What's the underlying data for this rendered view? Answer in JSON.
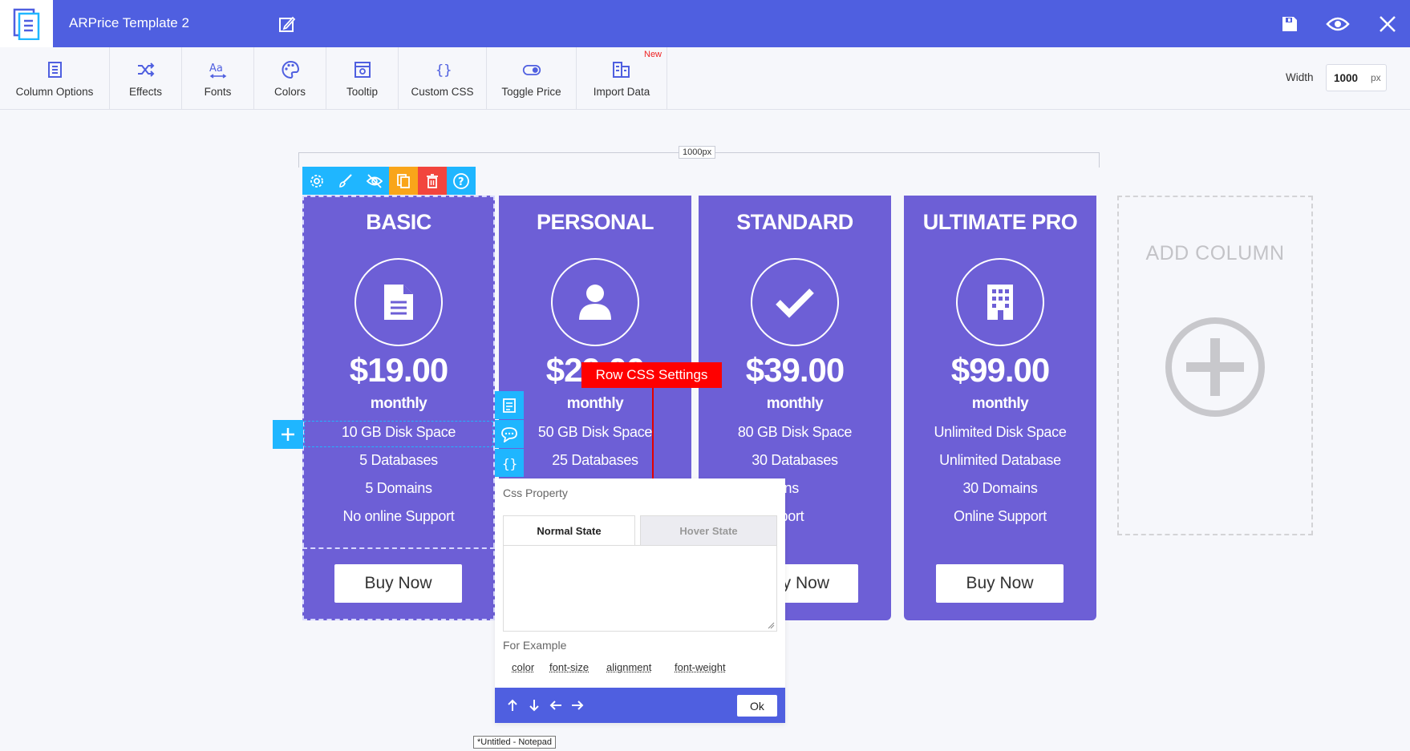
{
  "app": {
    "title": "ARPrice Template 2"
  },
  "toolbar": {
    "items": [
      {
        "label": "Column Options",
        "icon": "column-options-icon"
      },
      {
        "label": "Effects",
        "icon": "shuffle-icon"
      },
      {
        "label": "Fonts",
        "icon": "fonts-icon"
      },
      {
        "label": "Colors",
        "icon": "palette-icon"
      },
      {
        "label": "Tooltip",
        "icon": "tooltip-icon"
      },
      {
        "label": "Custom CSS",
        "icon": "braces-icon"
      },
      {
        "label": "Toggle Price",
        "icon": "toggle-icon"
      },
      {
        "label": "Import Data",
        "icon": "import-icon"
      }
    ],
    "new_badge": "New",
    "width_label": "Width",
    "width_value": "1000",
    "width_unit": "px"
  },
  "ruler_label": "1000px",
  "columns": [
    {
      "title": "BASIC",
      "icon": "document-icon",
      "price": "$19.00",
      "period": "monthly",
      "rows": [
        "10 GB Disk Space",
        "5 Databases",
        "5 Domains",
        "No online Support"
      ],
      "button": "Buy Now"
    },
    {
      "title": "PERSONAL",
      "icon": "user-icon",
      "price": "$29.00",
      "period": "monthly",
      "rows": [
        "50 GB Disk Space",
        "25 Databases",
        "",
        ""
      ],
      "button": ""
    },
    {
      "title": "STANDARD",
      "icon": "checkmark-icon",
      "price": "$39.00",
      "period": "monthly",
      "rows": [
        "80 GB Disk Space",
        "30 Databases",
        "Domains",
        "e Support"
      ],
      "button": "y Now"
    },
    {
      "title": "ULTIMATE PRO",
      "icon": "building-icon",
      "price": "$99.00",
      "period": "monthly",
      "rows": [
        "Unlimited Disk Space",
        "Unlimited Database",
        "30 Domains",
        "Online Support"
      ],
      "button": "Buy Now"
    }
  ],
  "add_column": {
    "label": "ADD COLUMN"
  },
  "tooltip": {
    "text": "Row CSS Settings"
  },
  "css_panel": {
    "title": "Css Property",
    "tabs": [
      "Normal State",
      "Hover State"
    ],
    "example_label": "For Example",
    "examples": [
      "color",
      "font-size",
      "alignment",
      "font-weight"
    ],
    "ok_label": "Ok"
  },
  "taskbar_tooltip": "*Untitled - Notepad",
  "colors": {
    "topbar": "#4f5fe0",
    "column": "#6d5fd6",
    "accent_blue": "#1fb6ff",
    "tool_orange": "#f9a51a",
    "tool_red": "#f2453d",
    "tooltip_red": "#ff0000"
  }
}
